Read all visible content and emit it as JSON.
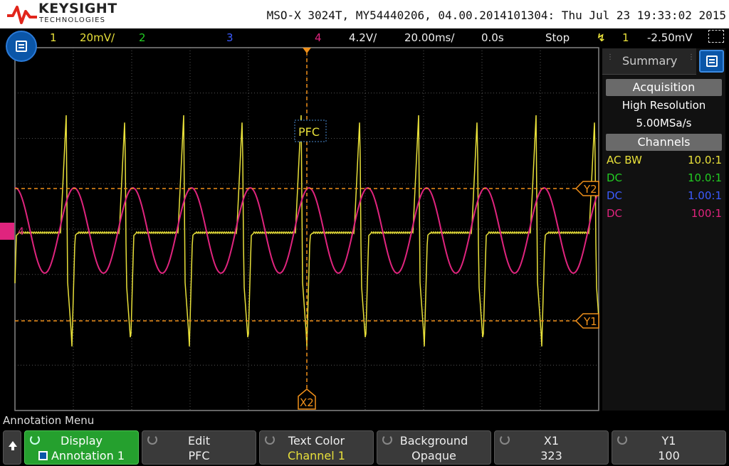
{
  "header": {
    "brand": "KEYSIGHT",
    "brand_sub": "TECHNOLOGIES",
    "instrument": "MSO-X 3024T, MY54440206, 04.00.2014101304: Thu Jul 23 19:33:02 2015"
  },
  "status": {
    "ch1_num": "1",
    "ch1_scale": "20mV/",
    "ch2_num": "2",
    "ch3_num": "3",
    "ch4_num": "4",
    "ch4_scale": "4.2V/",
    "timebase": "20.00ms/",
    "delay": "0.0s",
    "run_state": "Stop",
    "trig_source": "1",
    "trig_level": "-2.50mV"
  },
  "colors": {
    "ch1": "#e8e03a",
    "ch2": "#22cc22",
    "ch3": "#3b5bff",
    "ch4": "#e0247e",
    "cursor": "#f0901a",
    "grid": "#555555"
  },
  "display": {
    "annotation_text": "PFC",
    "cursor_y2": "Y2",
    "cursor_y1": "Y1",
    "cursor_x2": "X2",
    "ch4_marker": "4"
  },
  "side_panel": {
    "tab": "Summary",
    "acq_header": "Acquisition",
    "acq_mode": "High Resolution",
    "acq_rate": "5.00MSa/s",
    "channels_header": "Channels",
    "channels": [
      {
        "coupling": "AC  BW",
        "probe": "10.0:1"
      },
      {
        "coupling": "DC",
        "probe": "10.0:1"
      },
      {
        "coupling": "DC",
        "probe": "1.00:1"
      },
      {
        "coupling": "DC",
        "probe": "100:1"
      }
    ]
  },
  "softkeys": {
    "menu_title": "Annotation Menu",
    "keys": [
      {
        "top": "Display",
        "bottom": "Annotation 1"
      },
      {
        "top": "Edit",
        "bottom": "PFC"
      },
      {
        "top": "Text Color",
        "bottom": "Channel 1"
      },
      {
        "top": "Background",
        "bottom": "Opaque"
      },
      {
        "top": "X1",
        "bottom": "323"
      },
      {
        "top": "Y1",
        "bottom": "100"
      }
    ]
  }
}
